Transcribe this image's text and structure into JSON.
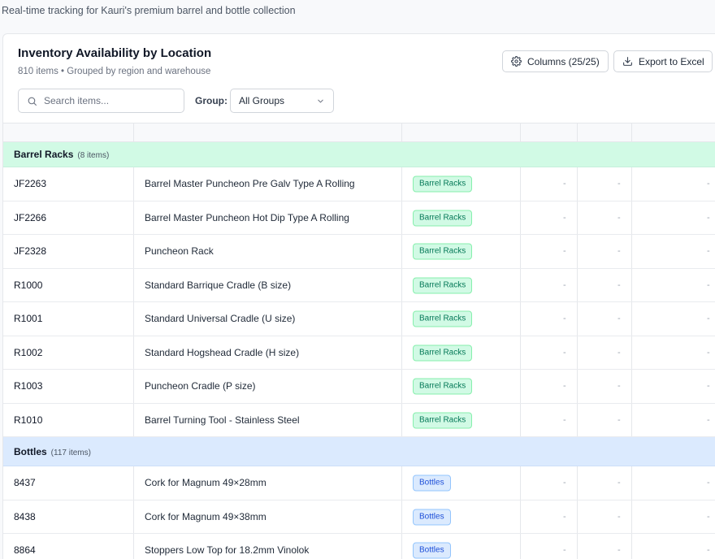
{
  "page": {
    "subtitle": "Real-time tracking for Kauri's premium barrel and bottle collection"
  },
  "card": {
    "title": "Inventory Availability by Location",
    "summary": "810 items • Grouped by region and warehouse",
    "columns_button": "Columns (25/25)",
    "export_button": "Export to Excel",
    "search_placeholder": "Search items...",
    "group_label": "Group:",
    "group_value": "All Groups"
  },
  "colors": {
    "green_group": "#d1fae5",
    "blue_group": "#dbeafe"
  },
  "icons": {
    "columns": "gear-icon",
    "export": "download-icon",
    "search": "search-icon",
    "select": "chevron-down-icon"
  },
  "table": {
    "empty_value": "-",
    "groups": [
      {
        "name": "Barrel Racks",
        "count": "(8 items)",
        "color": "green",
        "rows": [
          {
            "code": "JF2263",
            "name": "Barrel Master Puncheon Pre Galv Type A Rolling",
            "category": "Barrel Racks"
          },
          {
            "code": "JF2266",
            "name": "Barrel Master Puncheon Hot Dip Type A Rolling",
            "category": "Barrel Racks"
          },
          {
            "code": "JF2328",
            "name": "Puncheon Rack",
            "category": "Barrel Racks"
          },
          {
            "code": "R1000",
            "name": "Standard Barrique Cradle (B size)",
            "category": "Barrel Racks"
          },
          {
            "code": "R1001",
            "name": "Standard Universal Cradle (U size)",
            "category": "Barrel Racks"
          },
          {
            "code": "R1002",
            "name": "Standard Hogshead Cradle (H size)",
            "category": "Barrel Racks"
          },
          {
            "code": "R1003",
            "name": "Puncheon Cradle (P size)",
            "category": "Barrel Racks"
          },
          {
            "code": "R1010",
            "name": "Barrel Turning Tool - Stainless Steel",
            "category": "Barrel Racks"
          }
        ]
      },
      {
        "name": "Bottles",
        "count": "(117 items)",
        "color": "blue",
        "rows": [
          {
            "code": "8437",
            "name": "Cork for Magnum 49×28mm",
            "category": "Bottles"
          },
          {
            "code": "8438",
            "name": "Cork for Magnum 49×38mm",
            "category": "Bottles"
          },
          {
            "code": "8864",
            "name": "Stoppers Low Top for 18.2mm Vinolok",
            "category": "Bottles"
          }
        ]
      }
    ]
  }
}
